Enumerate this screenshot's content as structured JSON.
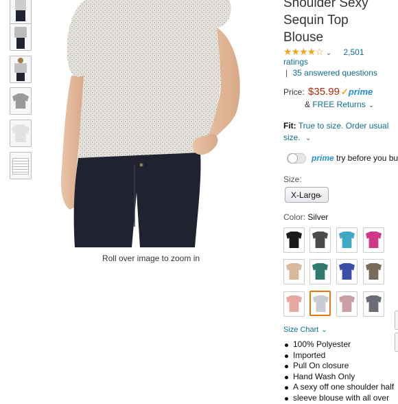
{
  "product": {
    "title_lines": [
      "Shoulder Sexy",
      "Sequin Top",
      "Blouse"
    ],
    "rating_stars": 4.0,
    "rating_count": "2,501",
    "ratings_word": "ratings",
    "answered_questions": "35 answered questions",
    "price_label": "Price:",
    "price": "$35.99",
    "prime_check": "✓",
    "prime_label": "prime",
    "returns_prefix": "& ",
    "returns_link": "FREE Returns",
    "fit_label": "Fit:",
    "fit_text": "True to size. Order usual size.",
    "prime_try_word": "prime",
    "prime_try_rest": " try before you buy",
    "size_label": "Size:",
    "size_selected": "X-Large",
    "color_label": "Color:",
    "color_selected": "Silver",
    "size_chart": "Size Chart",
    "bullets": [
      "100% Polyester",
      "Imported",
      "Pull On closure",
      "Hand Wash Only",
      "A sexy off one shoulder half",
      "sleeve blouse with all over"
    ]
  },
  "gallery": {
    "zoom_hint": "Roll over image to zoom in",
    "thumbnails": [
      "front-model",
      "side-model",
      "back-model",
      "flat-gray",
      "flat-white",
      "size-chart"
    ]
  },
  "colors": {
    "accent_link": "#0f6e8f",
    "price": "#b12704",
    "star": "#f0a41c",
    "prime": "#1f8fcf",
    "selected_border": "#e47911"
  },
  "swatches": [
    {
      "name": "black",
      "color": "#1a1a1a"
    },
    {
      "name": "dark-gray",
      "color": "#4a4a4a"
    },
    {
      "name": "turquoise",
      "color": "#3fa8c4"
    },
    {
      "name": "fuchsia",
      "color": "#d0368a"
    },
    {
      "name": "champagne",
      "color": "#d8b99a"
    },
    {
      "name": "emerald",
      "color": "#2f7a6a"
    },
    {
      "name": "royal-blue",
      "color": "#3b4fa8"
    },
    {
      "name": "bronze",
      "color": "#7a6a5a"
    },
    {
      "name": "rose-gold",
      "color": "#e6a8a0"
    },
    {
      "name": "silver",
      "color": "#c9ccd2",
      "selected": true
    },
    {
      "name": "pink-silver",
      "color": "#caa0a6"
    },
    {
      "name": "gunmetal",
      "color": "#6a6d74"
    }
  ]
}
